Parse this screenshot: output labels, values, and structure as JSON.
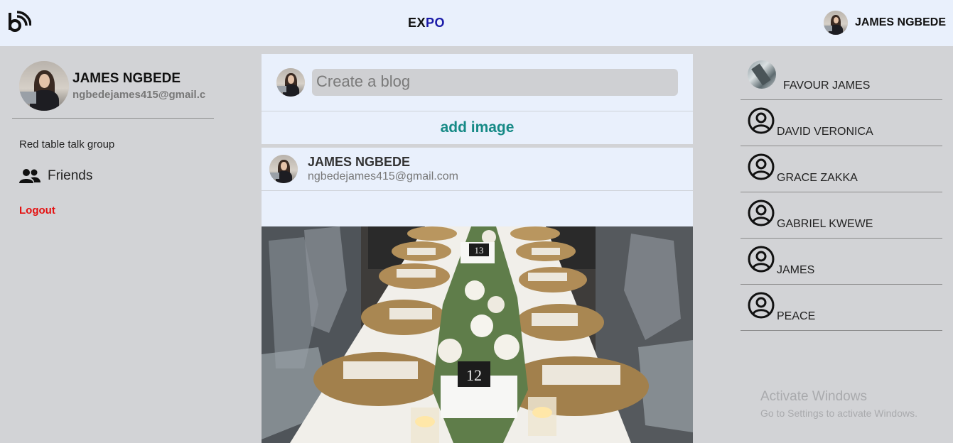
{
  "header": {
    "brand_part1": "EX",
    "brand_part2": "PO",
    "user_name": "JAMES NGBEDE"
  },
  "sidebar": {
    "profile_name": "JAMES NGBEDE",
    "profile_email": "ngbedejames415@gmail.c",
    "group_link": "Red table talk group",
    "friends_label": "Friends",
    "logout_label": "Logout"
  },
  "composer": {
    "placeholder": "Create a blog",
    "add_image_label": "add image"
  },
  "post": {
    "author_name": "JAMES NGBEDE",
    "author_email": "ngbedejames415@gmail.com",
    "image_labels": [
      "13",
      "12"
    ]
  },
  "friends_list": [
    {
      "name": "FAVOUR JAMES",
      "icon": "photo-avatar"
    },
    {
      "name": "DAVID VERONICA",
      "icon": "user-circle-icon"
    },
    {
      "name": "GRACE ZAKKA",
      "icon": "user-circle-icon"
    },
    {
      "name": "GABRIEL KWEWE",
      "icon": "user-circle-icon"
    },
    {
      "name": "JAMES",
      "icon": "user-circle-icon"
    },
    {
      "name": "PEACE",
      "icon": "user-circle-icon"
    }
  ],
  "watermark": {
    "title": "Activate Windows",
    "subtitle": "Go to Settings to activate Windows."
  }
}
